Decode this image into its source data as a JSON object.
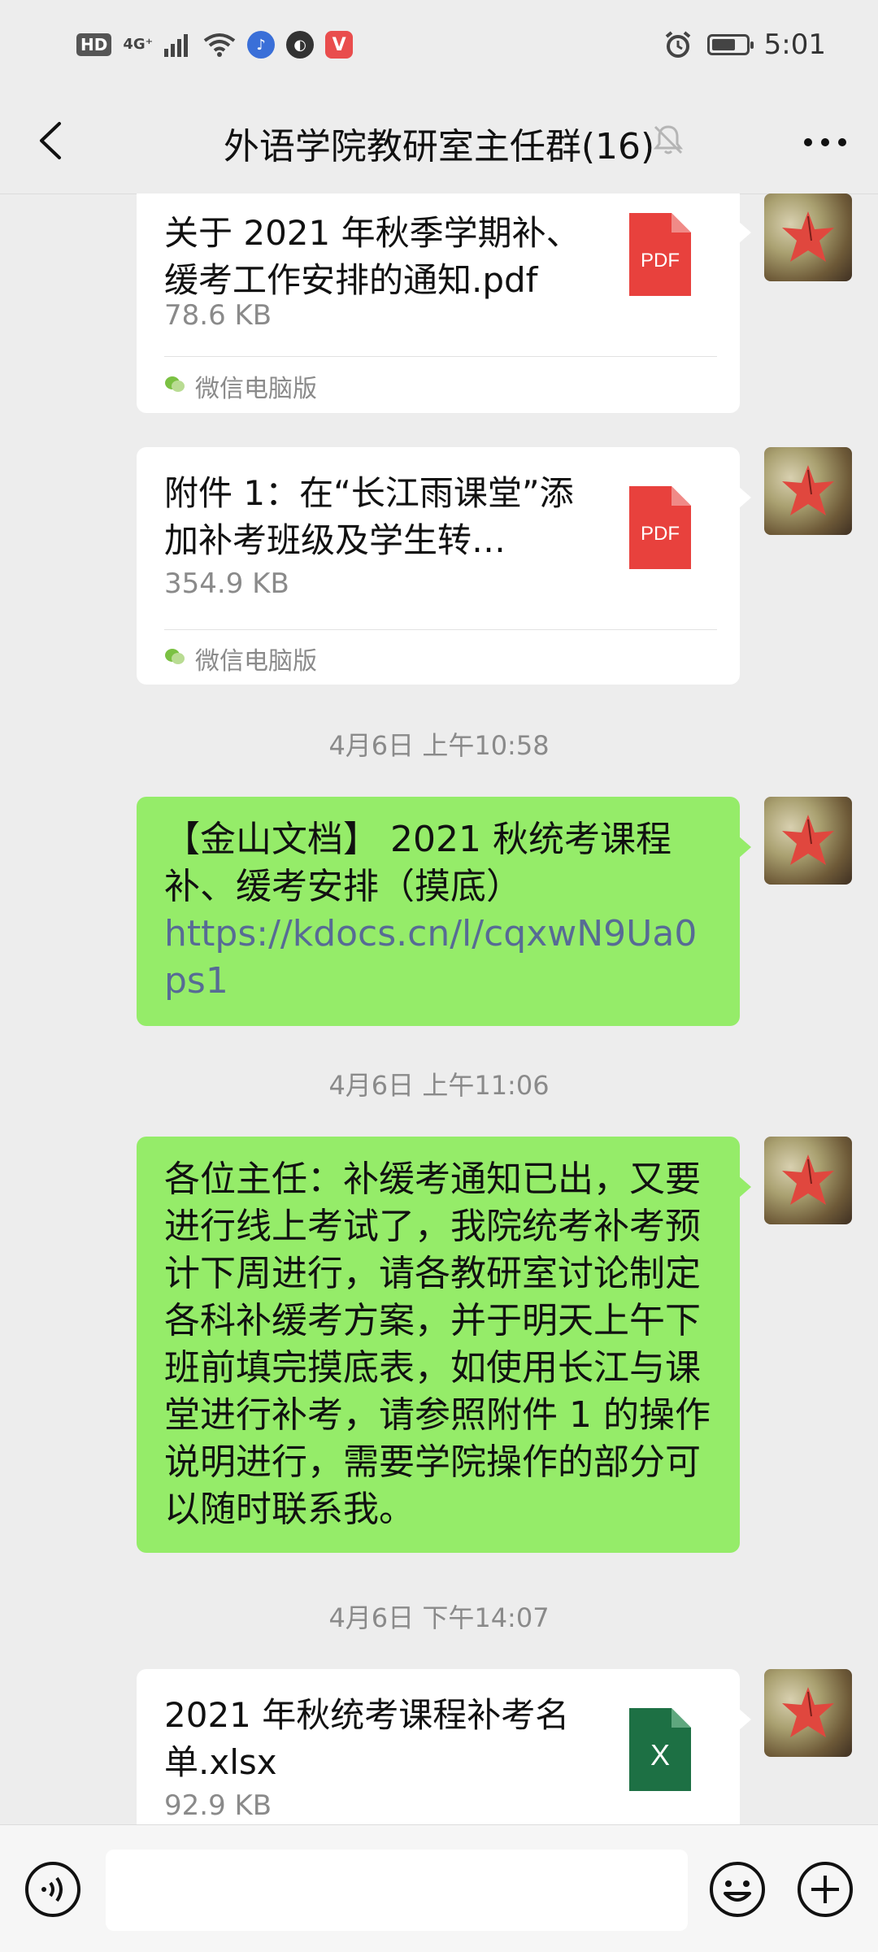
{
  "status_bar": {
    "hd": "HD",
    "network": "4G⁺",
    "time": "5:01",
    "battery_level": 0.7
  },
  "header": {
    "title": "外语学院教研室主任群(16)"
  },
  "messages": [
    {
      "type": "file",
      "name": "关于 2021 年秋季学期补、缓考工作安排的通知.pdf",
      "size": "78.6 KB",
      "source": "微信电脑版",
      "file_icon_label": "PDF"
    },
    {
      "type": "file",
      "name": "附件 1：在“长江雨课堂”添加补考班级及学生转…",
      "size": "354.9 KB",
      "source": "微信电脑版",
      "file_icon_label": "PDF"
    },
    {
      "type": "timestamp",
      "text": "4月6日 上午10:58"
    },
    {
      "type": "text",
      "text": "【金山文档】 2021 秋统考课程补、缓考安排（摸底）",
      "link": "https://kdocs.cn/l/cqxwN9Ua0ps1"
    },
    {
      "type": "timestamp",
      "text": "4月6日 上午11:06"
    },
    {
      "type": "text",
      "text": "各位主任：补缓考通知已出，又要进行线上考试了，我院统考补考预计下周进行，请各教研室讨论制定各科补缓考方案，并于明天上午下班前填完摸底表，如使用长江与课堂进行补考，请参照附件 1 的操作说明进行，需要学院操作的部分可以随时联系我。"
    },
    {
      "type": "timestamp",
      "text": "4月6日 下午14:07"
    },
    {
      "type": "file",
      "name": "2021 年秋统考课程补考名单.xlsx",
      "size": "92.9 KB",
      "file_icon_label": "X"
    }
  ],
  "colors": {
    "background": "#ededed",
    "bubble_self": "#95ec69",
    "bubble_card": "#ffffff",
    "pdf_red": "#e8413d",
    "excel_green": "#1d7044",
    "link": "#576b95"
  }
}
